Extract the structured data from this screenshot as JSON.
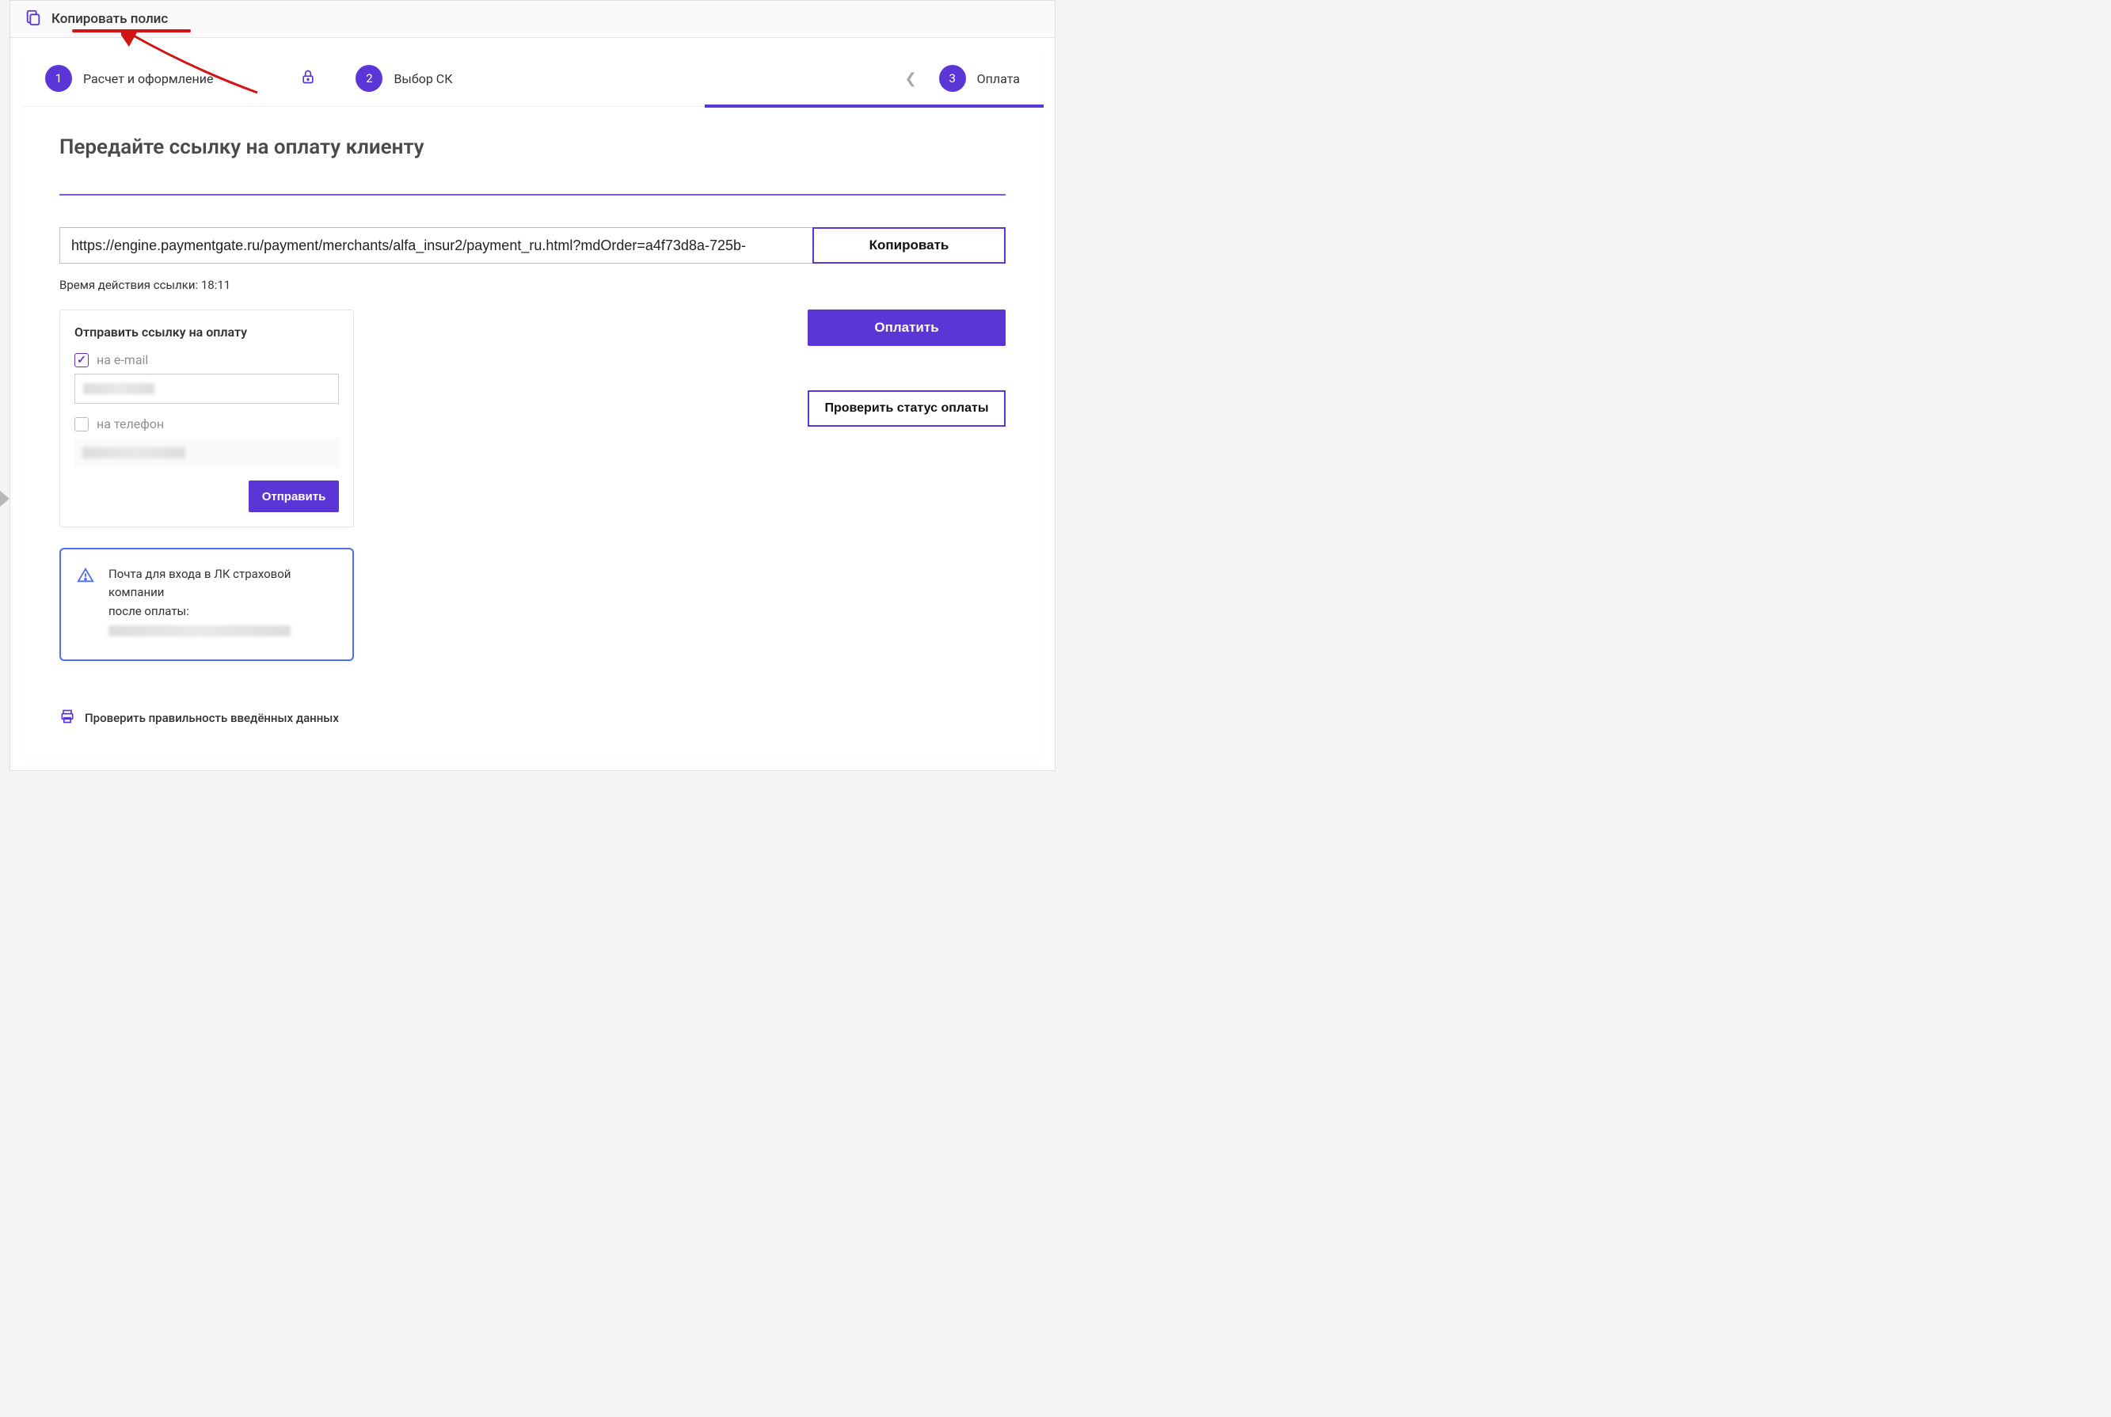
{
  "topbar": {
    "copy_policy": "Копировать полис"
  },
  "stepper": {
    "steps": [
      {
        "num": "1",
        "label": "Расчет и оформление"
      },
      {
        "num": "2",
        "label": "Выбор СК"
      },
      {
        "num": "3",
        "label": "Оплата"
      }
    ]
  },
  "heading": "Передайте ссылку на оплату клиенту",
  "payment_link": "https://engine.paymentgate.ru/payment/merchants/alfa_insur2/payment_ru.html?mdOrder=a4f73d8a-725b-",
  "copy_button": "Копировать",
  "countdown_prefix": "Время действия ссылки: ",
  "countdown_time": "18:11",
  "send_box": {
    "title": "Отправить ссылку на оплату",
    "email_label": "на e-mail",
    "email_checked": true,
    "email_value": "",
    "phone_label": "на телефон",
    "phone_checked": false,
    "phone_value": "",
    "send_button": "Отправить"
  },
  "info_box": {
    "line1": "Почта для входа в ЛК страховой компании",
    "line2": "после оплаты:"
  },
  "pay_button": "Оплатить",
  "status_button": "Проверить статус оплаты",
  "footer_link": "Проверить правильность введённых данных"
}
